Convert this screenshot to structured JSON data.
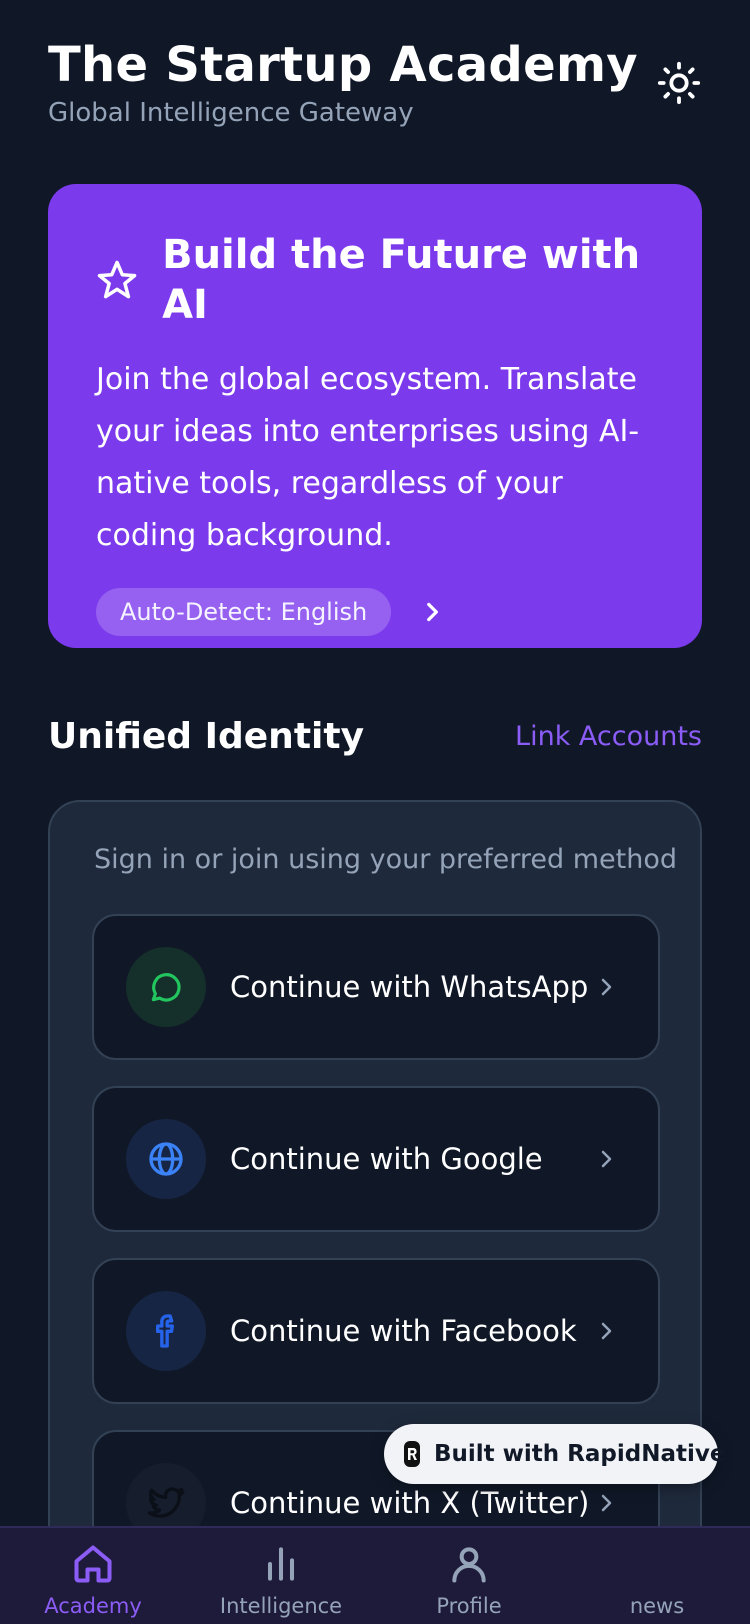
{
  "header": {
    "title": "The Startup Academy",
    "subtitle": "Global Intelligence Gateway",
    "theme_toggle_icon": "sun-icon"
  },
  "hero": {
    "icon": "star-icon",
    "title": "Build the Future with AI",
    "body": "Join the global ecosystem. Translate your ideas into enterprises using AI-native tools, regardless of your coding background.",
    "language_pill": "Auto-Detect: English",
    "color": "#7c3aed"
  },
  "identity": {
    "section_title": "Unified Identity",
    "link_label": "Link Accounts",
    "hint": "Sign in or join using your preferred method",
    "methods": [
      {
        "label": "Continue with WhatsApp",
        "icon": "whatsapp-icon",
        "color": "#22c55e"
      },
      {
        "label": "Continue with Google",
        "icon": "globe-icon",
        "color": "#3b82f6"
      },
      {
        "label": "Continue with Facebook",
        "icon": "facebook-icon",
        "color": "#2563eb"
      },
      {
        "label": "Continue with X (Twitter)",
        "icon": "twitter-icon",
        "color": "#111111"
      }
    ]
  },
  "badge": {
    "text": "Built with RapidNative"
  },
  "tabbar": {
    "tabs": [
      {
        "label": "Academy",
        "icon": "home-icon",
        "active": true
      },
      {
        "label": "Intelligence",
        "icon": "bar-chart-icon",
        "active": false
      },
      {
        "label": "Profile",
        "icon": "user-icon",
        "active": false
      },
      {
        "label": "news",
        "icon": "news-icon",
        "active": false
      }
    ]
  },
  "colors": {
    "background": "#101828",
    "accent": "#8b5cf6",
    "card": "#1e293b"
  }
}
